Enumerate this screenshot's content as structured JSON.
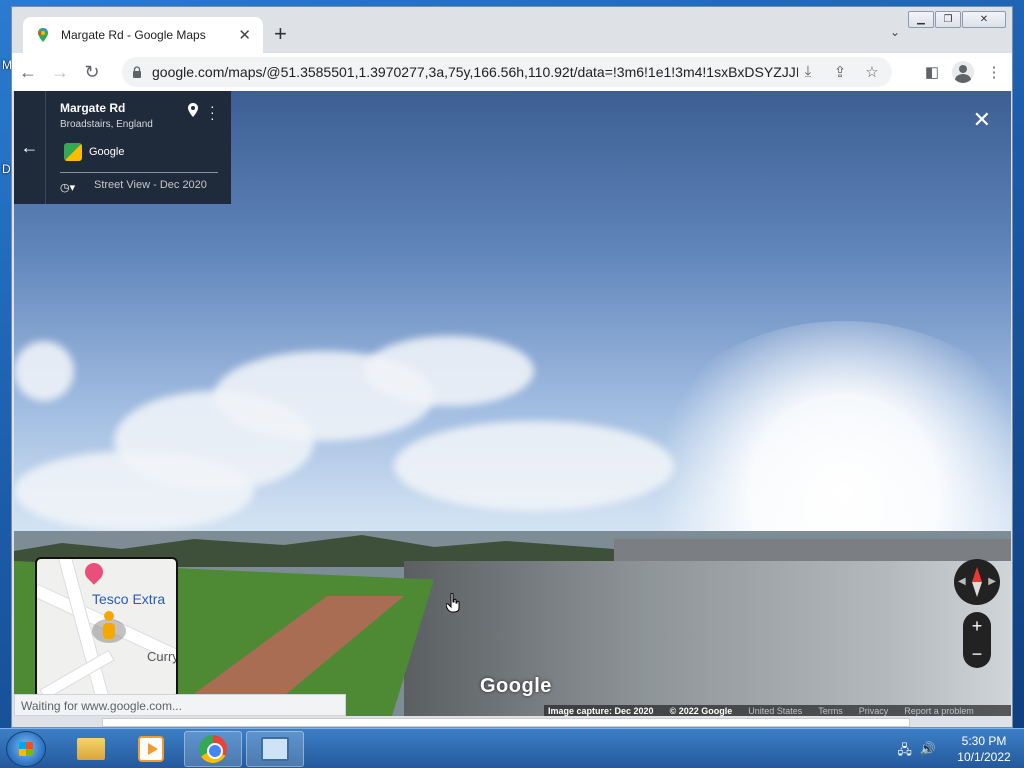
{
  "browser": {
    "tab_title": "Margate Rd - Google Maps",
    "url": "google.com/maps/@51.3585501,1.3970277,3a,75y,166.56h,110.92t/data=!3m6!1e1!3m4!1sxBxDSYZJJI...",
    "status_text": "Waiting for www.google.com..."
  },
  "info_card": {
    "title": "Margate Rd",
    "subtitle": "Broadstairs, England",
    "provider": "Google",
    "date_label": "Street View - Dec 2020"
  },
  "minimap": {
    "poi_label": "Tesco Extra",
    "partial_label": "Curry"
  },
  "streetview": {
    "watermark": "Google",
    "image_capture": "Image capture: Dec 2020",
    "copyright": "© 2022 Google",
    "country": "United States",
    "terms": "Terms",
    "privacy": "Privacy",
    "report": "Report a problem",
    "zoom_in": "+",
    "zoom_out": "−"
  },
  "taskbar": {
    "time": "5:30 PM",
    "date": "10/1/2022"
  },
  "desktop": {
    "glyph_m": "M",
    "glyph_d": "D"
  }
}
